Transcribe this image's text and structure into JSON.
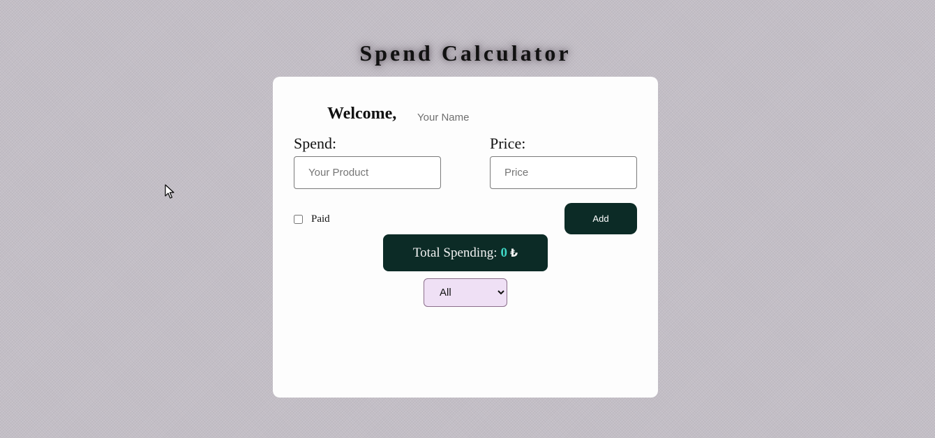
{
  "app": {
    "title": "Spend Calculator"
  },
  "welcome": {
    "label": "Welcome,",
    "name_placeholder": "Your Name",
    "name_value": ""
  },
  "form": {
    "spend_label": "Spend:",
    "spend_placeholder": "Your Product",
    "price_label": "Price:",
    "price_placeholder": "Price",
    "paid_label": "Paid",
    "paid_checked": false,
    "add_label": "Add"
  },
  "total": {
    "label": "Total Spending:",
    "amount": "0",
    "currency": "₺"
  },
  "filter": {
    "selected": "All"
  },
  "colors": {
    "dark_accent": "#0c2b26",
    "amount_color": "#3ed6c4",
    "select_background": "#efe0f5",
    "page_background": "#c3bec6",
    "card_background": "#fdfdfd"
  }
}
